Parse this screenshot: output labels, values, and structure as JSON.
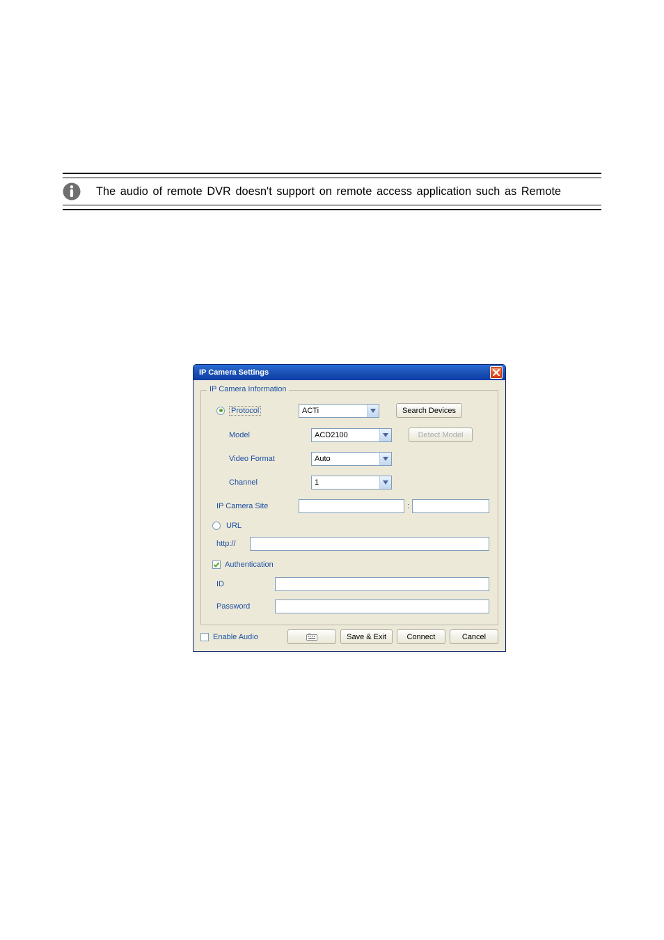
{
  "note": {
    "text": "The audio of remote DVR doesn't support on remote access application such as Remote"
  },
  "dialog": {
    "title": "IP Camera Settings",
    "group": {
      "legend": "IP Camera Information",
      "protocol": {
        "label": "Protocol",
        "value": "ACTi",
        "search_btn": "Search Devices"
      },
      "model": {
        "label": "Model",
        "value": "ACD2100",
        "detect_btn": "Detect Model"
      },
      "video_format": {
        "label": "Video Format",
        "value": "Auto"
      },
      "channel": {
        "label": "Channel",
        "value": "1"
      },
      "ip_site": {
        "label": "IP Camera Site",
        "value": "",
        "sep": ":",
        "port": ""
      },
      "url": {
        "label": "URL",
        "prefix": "http://",
        "value": ""
      },
      "auth": {
        "label": "Authentication",
        "id_label": "ID",
        "id_value": "",
        "pw_label": "Password",
        "pw_value": ""
      }
    },
    "bottom": {
      "enable_audio": "Enable Audio",
      "save_exit": "Save & Exit",
      "connect": "Connect",
      "cancel": "Cancel"
    }
  }
}
